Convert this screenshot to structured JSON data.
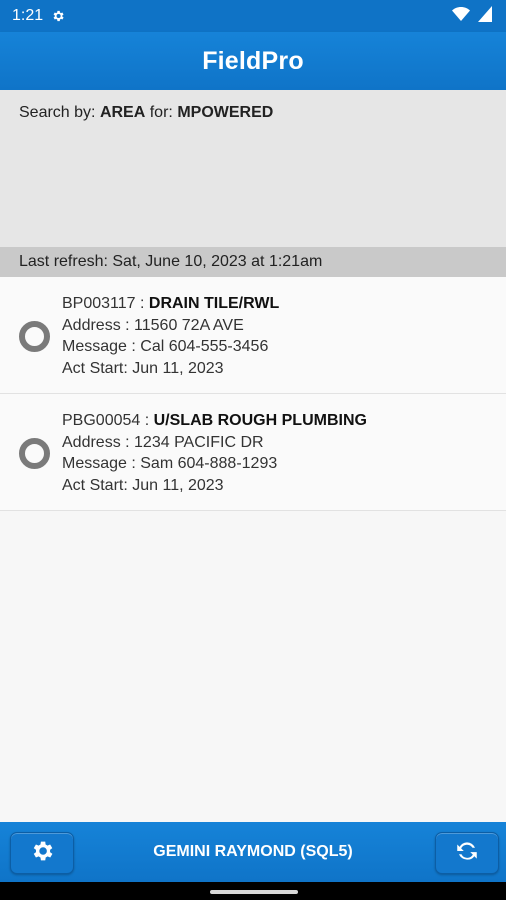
{
  "status": {
    "time": "1:21",
    "icons": [
      "gear-icon",
      "wifi-icon",
      "battery-icon"
    ]
  },
  "app": {
    "title": "FieldPro",
    "accent": "#0f73c6"
  },
  "search": {
    "label_prefix": "Search by:",
    "by": "AREA",
    "label_for": "for:",
    "value": "MPOWERED"
  },
  "refresh": {
    "text": "Last refresh: Sat, June 10, 2023 at 1:21am"
  },
  "items": [
    {
      "code": "BP003117",
      "separator": " : ",
      "job": "DRAIN TILE/RWL",
      "address": "Address : 11560 72A AVE",
      "message": "Message : Cal 604-555-3456",
      "act_start": "Act Start: Jun 11, 2023"
    },
    {
      "code": "PBG00054",
      "separator": " : ",
      "job": "U/SLAB ROUGH PLUMBING",
      "address": "Address : 1234 PACIFIC DR",
      "message": "Message : Sam 604-888-1293",
      "act_start": "Act Start: Jun 11, 2023"
    }
  ],
  "bottom": {
    "user": "GEMINI RAYMOND (SQL5)",
    "left_icon": "settings-icon",
    "right_icon": "sync-icon"
  }
}
